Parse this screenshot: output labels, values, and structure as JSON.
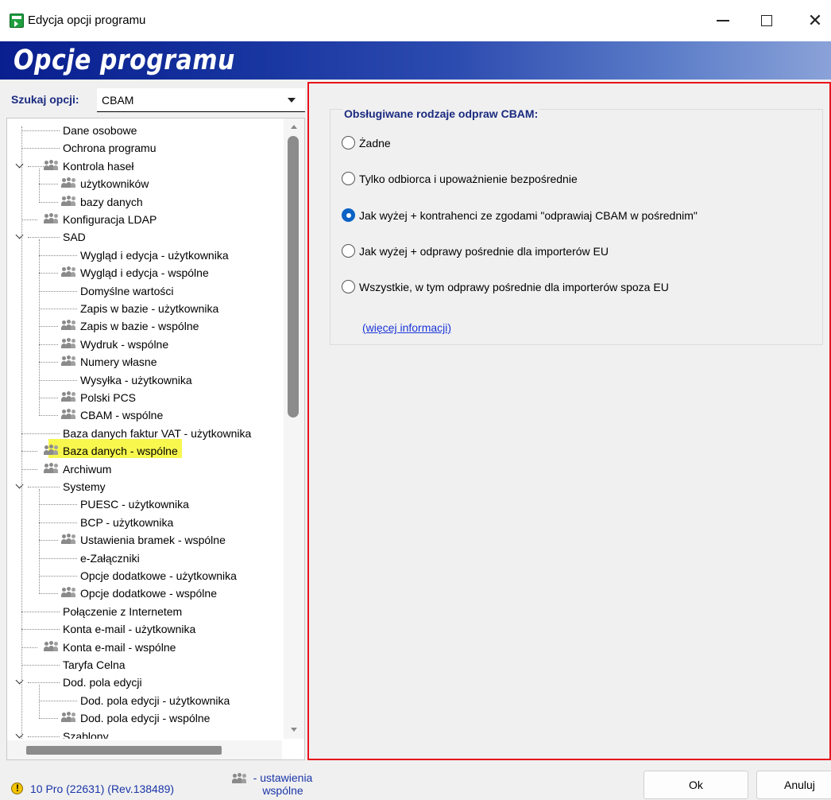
{
  "window": {
    "title": "Edycja opcji programu",
    "minimize": "—",
    "close": "✕"
  },
  "banner": {
    "title": "Opcje programu"
  },
  "search": {
    "label": "Szukaj opcji:",
    "value": "CBAM"
  },
  "tree": {
    "items": [
      {
        "label": "Dane osobowe",
        "level": 1,
        "icon": false,
        "expander": false
      },
      {
        "label": "Ochrona programu",
        "level": 1,
        "icon": false,
        "expander": false
      },
      {
        "label": "Kontrola haseł",
        "level": 1,
        "icon": true,
        "expander": true
      },
      {
        "label": "użytkowników",
        "level": 2,
        "icon": true,
        "expander": false
      },
      {
        "label": "bazy danych",
        "level": 2,
        "icon": true,
        "expander": false
      },
      {
        "label": "Konfiguracja LDAP",
        "level": 1,
        "icon": true,
        "expander": false
      },
      {
        "label": "SAD",
        "level": 1,
        "icon": false,
        "expander": true
      },
      {
        "label": "Wygląd i edycja - użytkownika",
        "level": 2,
        "icon": false,
        "expander": false
      },
      {
        "label": "Wygląd i edycja - wspólne",
        "level": 2,
        "icon": true,
        "expander": false
      },
      {
        "label": "Domyślne wartości",
        "level": 2,
        "icon": false,
        "expander": false
      },
      {
        "label": "Zapis w bazie - użytkownika",
        "level": 2,
        "icon": false,
        "expander": false
      },
      {
        "label": "Zapis w bazie - wspólne",
        "level": 2,
        "icon": true,
        "expander": false
      },
      {
        "label": "Wydruk - wspólne",
        "level": 2,
        "icon": true,
        "expander": false
      },
      {
        "label": "Numery własne",
        "level": 2,
        "icon": true,
        "expander": false
      },
      {
        "label": "Wysyłka - użytkownika",
        "level": 2,
        "icon": false,
        "expander": false
      },
      {
        "label": "Polski PCS",
        "level": 2,
        "icon": true,
        "expander": false
      },
      {
        "label": "CBAM - wspólne",
        "level": 2,
        "icon": true,
        "expander": false,
        "selected": true
      },
      {
        "label": "Baza danych faktur VAT - użytkownika",
        "level": 1,
        "icon": false,
        "expander": false
      },
      {
        "label": "Baza danych - wspólne",
        "level": 1,
        "icon": true,
        "expander": false
      },
      {
        "label": "Archiwum",
        "level": 1,
        "icon": true,
        "expander": false
      },
      {
        "label": "Systemy",
        "level": 1,
        "icon": false,
        "expander": true
      },
      {
        "label": "PUESC - użytkownika",
        "level": 2,
        "icon": false,
        "expander": false
      },
      {
        "label": "BCP - użytkownika",
        "level": 2,
        "icon": false,
        "expander": false
      },
      {
        "label": "Ustawienia bramek - wspólne",
        "level": 2,
        "icon": true,
        "expander": false
      },
      {
        "label": "e-Załączniki",
        "level": 2,
        "icon": false,
        "expander": false
      },
      {
        "label": "Opcje dodatkowe - użytkownika",
        "level": 2,
        "icon": false,
        "expander": false
      },
      {
        "label": "Opcje dodatkowe - wspólne",
        "level": 2,
        "icon": true,
        "expander": false
      },
      {
        "label": "Połączenie z Internetem",
        "level": 1,
        "icon": false,
        "expander": false
      },
      {
        "label": "Konta e-mail - użytkownika",
        "level": 1,
        "icon": false,
        "expander": false
      },
      {
        "label": "Konta e-mail - wspólne",
        "level": 1,
        "icon": true,
        "expander": false
      },
      {
        "label": "Taryfa Celna",
        "level": 1,
        "icon": false,
        "expander": false
      },
      {
        "label": "Dod. pola edycji",
        "level": 1,
        "icon": false,
        "expander": true
      },
      {
        "label": "Dod. pola edycji - użytkownika",
        "level": 2,
        "icon": false,
        "expander": false
      },
      {
        "label": "Dod. pola edycji - wspólne",
        "level": 2,
        "icon": true,
        "expander": false
      },
      {
        "label": "Szablony",
        "level": 1,
        "icon": false,
        "expander": true
      }
    ]
  },
  "options": {
    "group_title": "Obsługiwane rodzaje odpraw CBAM:",
    "radios": [
      {
        "label": "Żadne",
        "checked": false
      },
      {
        "label": "Tylko odbiorca i upoważnienie bezpośrednie",
        "checked": false
      },
      {
        "label": "Jak wyżej + kontrahenci ze zgodami \"odprawiaj CBAM w pośrednim\"",
        "checked": true
      },
      {
        "label": "Jak wyżej + odprawy pośrednie dla importerów EU",
        "checked": false
      },
      {
        "label": "Wszystkie, w tym odprawy pośrednie dla importerów spoza EU",
        "checked": false
      }
    ],
    "more_info": "(więcej informacji)"
  },
  "status": {
    "version": "10 Pro (22631) (Rev.138489)",
    "legend_line1": "- ustawienia",
    "legend_line2": "wspólne"
  },
  "buttons": {
    "ok": "Ok",
    "cancel": "Anuluj"
  },
  "colors": {
    "banner_start": "#0a1f8f",
    "banner_end": "#8aa2d8",
    "panel_border": "#e8141c",
    "highlight": "#f8f74e",
    "radio_checked": "#0a62c4"
  }
}
